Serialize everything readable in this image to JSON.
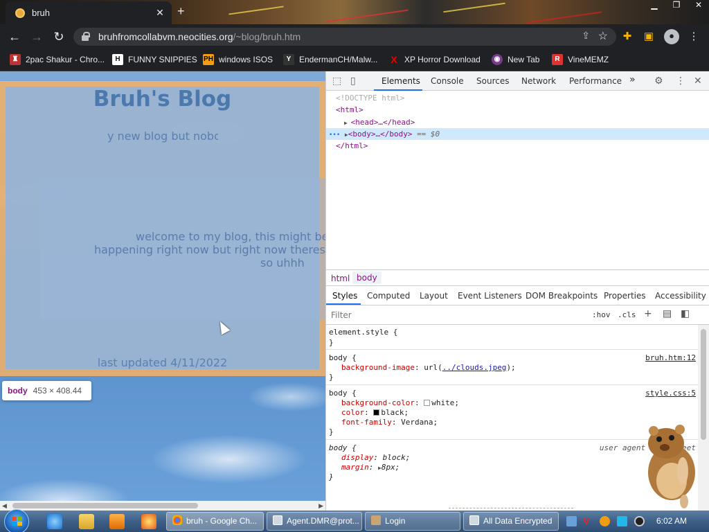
{
  "browser": {
    "tab_title": "bruh",
    "tab_close": "✕",
    "new_tab": "+",
    "url_host": "bruhfromcollabvm.neocities.org",
    "url_path": "/~blog/bruh.htm"
  },
  "bookmarks": [
    {
      "label": "2pac Shakur - Chro...",
      "icon": "tupac-icon",
      "color": "#b33"
    },
    {
      "label": "FUNNY SNIPPIES",
      "icon": "h-icon",
      "color": "#222"
    },
    {
      "label": "windows ISOS",
      "icon": "ph-icon",
      "color": "#f29c11"
    },
    {
      "label": "EndermanCH/Malw...",
      "icon": "youtube-icon",
      "color": "#c00"
    },
    {
      "label": "XP Horror Download",
      "icon": "x-icon",
      "color": "#d00"
    },
    {
      "label": "New Tab",
      "icon": "globe-icon",
      "color": "#7a3b8f"
    },
    {
      "label": "VineMEMZ",
      "icon": "r-icon",
      "color": "#d33"
    }
  ],
  "page": {
    "title": "Bruh's Blog",
    "subtitle": "y new blog but nobo",
    "welcome_line1": "welcome to my blog, this might be wh",
    "welcome_line2": "happening right now but right now theres",
    "welcome_line3": "so uhhh",
    "last_updated": "last updated 4/11/2022",
    "tooltip_tag": "body",
    "tooltip_size": "453 × 408.44"
  },
  "devtools": {
    "tabs": [
      "Elements",
      "Console",
      "Sources",
      "Network",
      "Performance"
    ],
    "more": "»",
    "dom": {
      "doctype": "<!DOCTYPE html>",
      "html_open": "<html>",
      "head": "<head>…</head>",
      "body": "<body>…</body>",
      "body_sel": "== $0",
      "html_close": "</html>"
    },
    "breadcrumbs": [
      "html",
      "body"
    ],
    "subtabs": [
      "Styles",
      "Computed",
      "Layout",
      "Event Listeners",
      "DOM Breakpoints",
      "Properties",
      "Accessibility"
    ],
    "filter_placeholder": "Filter",
    "hov": ":hov",
    "cls": ".cls",
    "rules": {
      "element_style": "element.style {",
      "close": "}",
      "r1_selector": "body {",
      "r1_source": "bruh.htm:12",
      "r1_prop": "background-image",
      "r1_val_pre": "url(",
      "r1_val_link": "../clouds.jpeg",
      "r1_val_post": ");",
      "r2_selector": "body {",
      "r2_source": "style.css:5",
      "r2_p1": "background-color",
      "r2_v1": "white;",
      "r2_p2": "color",
      "r2_v2": "black;",
      "r2_p3": "font-family",
      "r2_v3": "Verdana;",
      "r3_selector": "body {",
      "r3_source": "user agent stylesheet",
      "r3_p1": "display",
      "r3_v1": "block;",
      "r3_p2": "margin",
      "r3_v2": "8px;"
    }
  },
  "taskbar": {
    "buttons": [
      "bruh - Google Ch...",
      "Agent.DMR@prot...",
      "Login",
      "All Data Encrypted"
    ],
    "clock": "6:02 AM"
  }
}
